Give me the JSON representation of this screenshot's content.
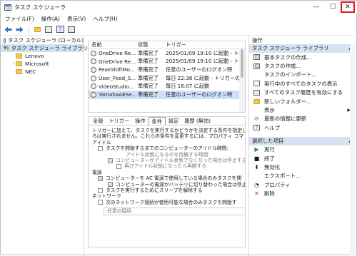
{
  "window": {
    "title": "タスク スケジューラ",
    "min": "—",
    "max": "☐",
    "close": "✕"
  },
  "menu": [
    "ファイル(F)",
    "操作(A)",
    "表示(V)",
    "ヘルプ(H)"
  ],
  "tree": {
    "root": "タスク スケジューラ (ローカル)",
    "library": "タスク スケジューラ ライブラリ",
    "folders": [
      "Lenovo",
      "Microsoft",
      "NEC"
    ]
  },
  "list": {
    "headers": [
      "名前",
      "状態",
      "トリガー"
    ],
    "rows": [
      {
        "name": "OneDrive Re...",
        "status": "準備完了",
        "trigger": "2025/01/09 19:10 に起動 - トリガ"
      },
      {
        "name": "OneDrive Re...",
        "status": "準備完了",
        "trigger": "2025/01/09 19:10 に起動 - トリガ"
      },
      {
        "name": "PeakShiftMo...",
        "status": "準備完了",
        "trigger": "任意のユーザーのログオン時"
      },
      {
        "name": "User_Feed_S...",
        "status": "準備完了",
        "trigger": "毎日 22:38 に起動 - トリガーの有す"
      },
      {
        "name": "VideoStudio...",
        "status": "準備完了",
        "trigger": "毎日 16:07 に起動"
      },
      {
        "name": "YamahaAESe...",
        "status": "準備完了",
        "trigger": "任意のユーザーのログオン時"
      }
    ]
  },
  "tabs": [
    "全般",
    "トリガー",
    "操作",
    "条件",
    "設定",
    "履歴 (無効)"
  ],
  "conditions": {
    "intro1": "トリガーに加えて、タスクを実行するかどうかを決定する条件を指定し",
    "intro2": "ろは実行されません。これらの条件を変更するには、プロパティ コマ",
    "idle_header": "アイドル",
    "idle_start": "タスクを開始するまでのコンピューターのアイドル時間:",
    "idle_wait": "アイドル状態になるのを待機する時間:",
    "idle_stop": "コンピューターがアイドル状態でなくなった場合は停止する",
    "idle_restart": "再びアイドル状態になったら再開する",
    "power_header": "電源",
    "power_ac": "コンピューターを AC 電源で使用している場合のみタスクを開",
    "power_battery": "コンピューターの電源がバッテリに切り替わった場合は停止す",
    "power_wake": "タスクを実行するためにスリープを解除する",
    "network_header": "ネットワーク",
    "network_start": "次のネットワーク接続が使用可能な場合のみタスクを開始す",
    "network_value": "任意の接続"
  },
  "actions": {
    "header": "操作",
    "section1": "タスク スケジューラ ライブラリ",
    "items1": [
      "基本タスクの作成...",
      "タスクの作成...",
      "タスクのインポート...",
      "実行中のすべてのタスクの表示",
      "すべてのタスク履歴を有効にする",
      "新しいフォルダー...",
      "表示",
      "最新の情報に更新",
      "ヘルプ"
    ],
    "section2": "選択した項目",
    "items2": [
      "実行",
      "終了",
      "無効化",
      "エクスポート...",
      "プロパティ",
      "削除"
    ]
  },
  "colors": {
    "selection": "#cce2f7",
    "section_bar": "#d6e3f3",
    "close_highlight": "#e21b1b"
  }
}
